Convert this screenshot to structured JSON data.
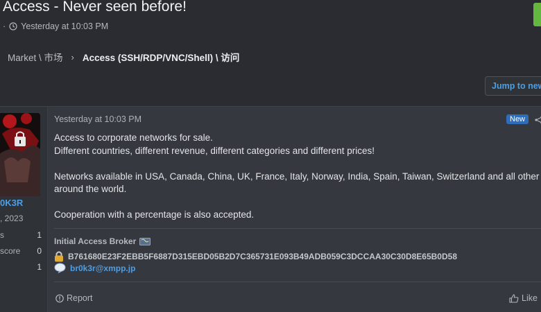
{
  "thread": {
    "title": "Access - Never seen before!",
    "meta_prefix": "·",
    "meta_time": "Yesterday at 10:03 PM"
  },
  "breadcrumb": {
    "parent": "Market \\ 市场",
    "separator": "›",
    "current": "Access (SSH/RDP/VNC/Shell) \\ 访问"
  },
  "jump_button": {
    "label": "Jump to new"
  },
  "user": {
    "name": "0K3R",
    "joined": ", 2023",
    "stats": [
      {
        "label": "s",
        "value": "1"
      },
      {
        "label": "score",
        "value": "0"
      },
      {
        "label": "",
        "value": "1"
      }
    ]
  },
  "post": {
    "date": "Yesterday at 10:03 PM",
    "badge": "New",
    "lines": {
      "l1": "Access to corporate networks for sale.",
      "l2": "Different countries, different revenue, different categories and different prices!",
      "l3": "Networks available in USA, Canada, China, UK, France, Italy, Norway, India, Spain, Taiwan, Switzerland and all other",
      "l4": "around the world.",
      "l5": "Cooperation with a percentage is also accepted."
    },
    "signature": {
      "title": "Initial Access Broker",
      "hash": "B761680E23F2EBB5F6887D315EBD05B2D7C365731E093B49ADB059C3DCCAA30C30D8E65B0D58",
      "contact": "br0k3r@xmpp.jp"
    },
    "actions": {
      "report": "Report",
      "like": "Like"
    }
  },
  "colors": {
    "background": "#2a2c31",
    "post_background": "#35383e",
    "link": "#4a9fe8",
    "badge": "#2f6db8",
    "green_tab": "#64b83f"
  }
}
